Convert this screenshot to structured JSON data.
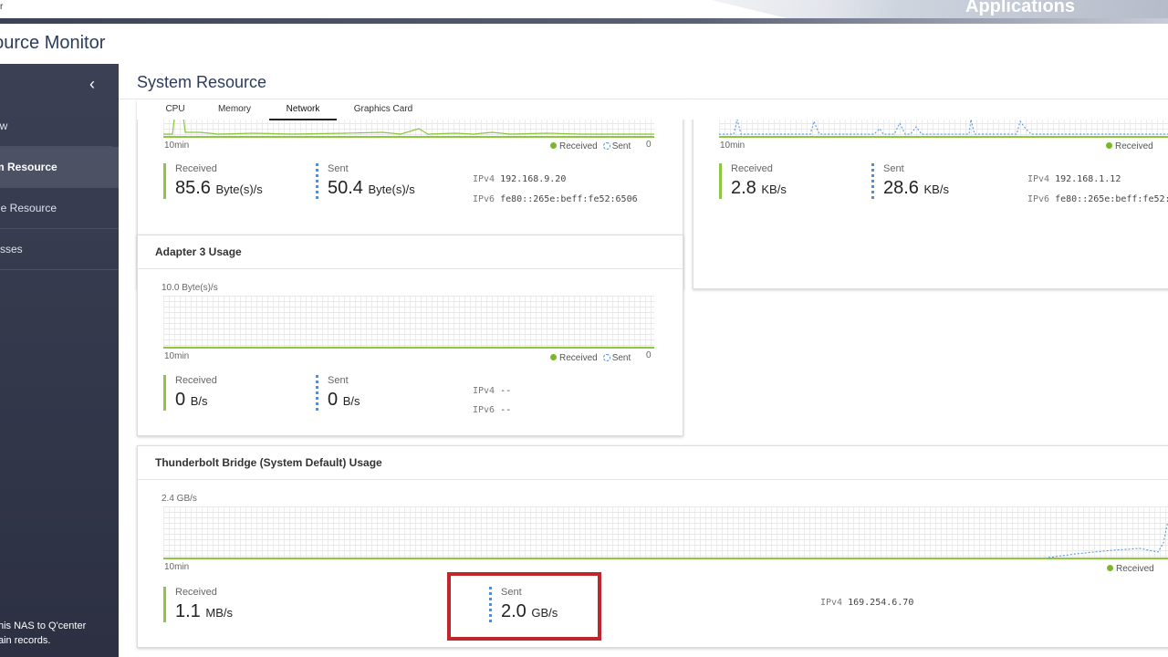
{
  "app": {
    "top_left_fragment": "r",
    "applications_label": "Applications",
    "window_title": "esource Monitor"
  },
  "sidebar": {
    "collapse_icon": "chevron-left-icon",
    "items": [
      {
        "label": "ew"
      },
      {
        "label": "m Resource"
      },
      {
        "label": "ge Resource"
      },
      {
        "label": "sses"
      }
    ],
    "footer_line1": "his NAS to Q'center",
    "footer_line2": "ain records."
  },
  "main": {
    "heading": "System Resource",
    "tabs": [
      {
        "label": "CPU"
      },
      {
        "label": "Memory"
      },
      {
        "label": "Network"
      },
      {
        "label": "Graphics Card"
      }
    ]
  },
  "common": {
    "time_label": "10min",
    "legend_received": "Received",
    "legend_sent": "Sent",
    "received_label": "Received",
    "sent_label": "Sent",
    "ipv4_key": "IPv4",
    "ipv6_key": "IPv6"
  },
  "adapter1": {
    "legend_zero": "0",
    "received_value": "85.6",
    "received_unit": "Byte(s)/s",
    "sent_value": "50.4",
    "sent_unit": "Byte(s)/s",
    "ipv4": "192.168.9.20",
    "ipv6": "fe80::265e:beff:fe52:6506"
  },
  "adapter2": {
    "received_value": "2.8",
    "received_unit": "KB/s",
    "sent_value": "28.6",
    "sent_unit": "KB/s",
    "ipv4": "192.168.1.12",
    "ipv6": "fe80::265e:beff:fe52:"
  },
  "adapter3": {
    "title": "Adapter 3 Usage",
    "ymax": "10.0 Byte(s)/s",
    "legend_zero": "0",
    "received_value": "0",
    "received_unit": "B/s",
    "sent_value": "0",
    "sent_unit": "B/s",
    "ipv4": "--",
    "ipv6": "--"
  },
  "thunderbolt": {
    "title": "Thunderbolt Bridge (System Default) Usage",
    "ymax": "2.4 GB/s",
    "received_value": "1.1",
    "received_unit": "MB/s",
    "sent_value": "2.0",
    "sent_unit": "GB/s",
    "ipv4": "169.254.6.70"
  },
  "colors": {
    "received": "#8dc63f",
    "sent": "#4a90e2",
    "sidebar": "#3b4054",
    "highlight": "#c0272d"
  }
}
